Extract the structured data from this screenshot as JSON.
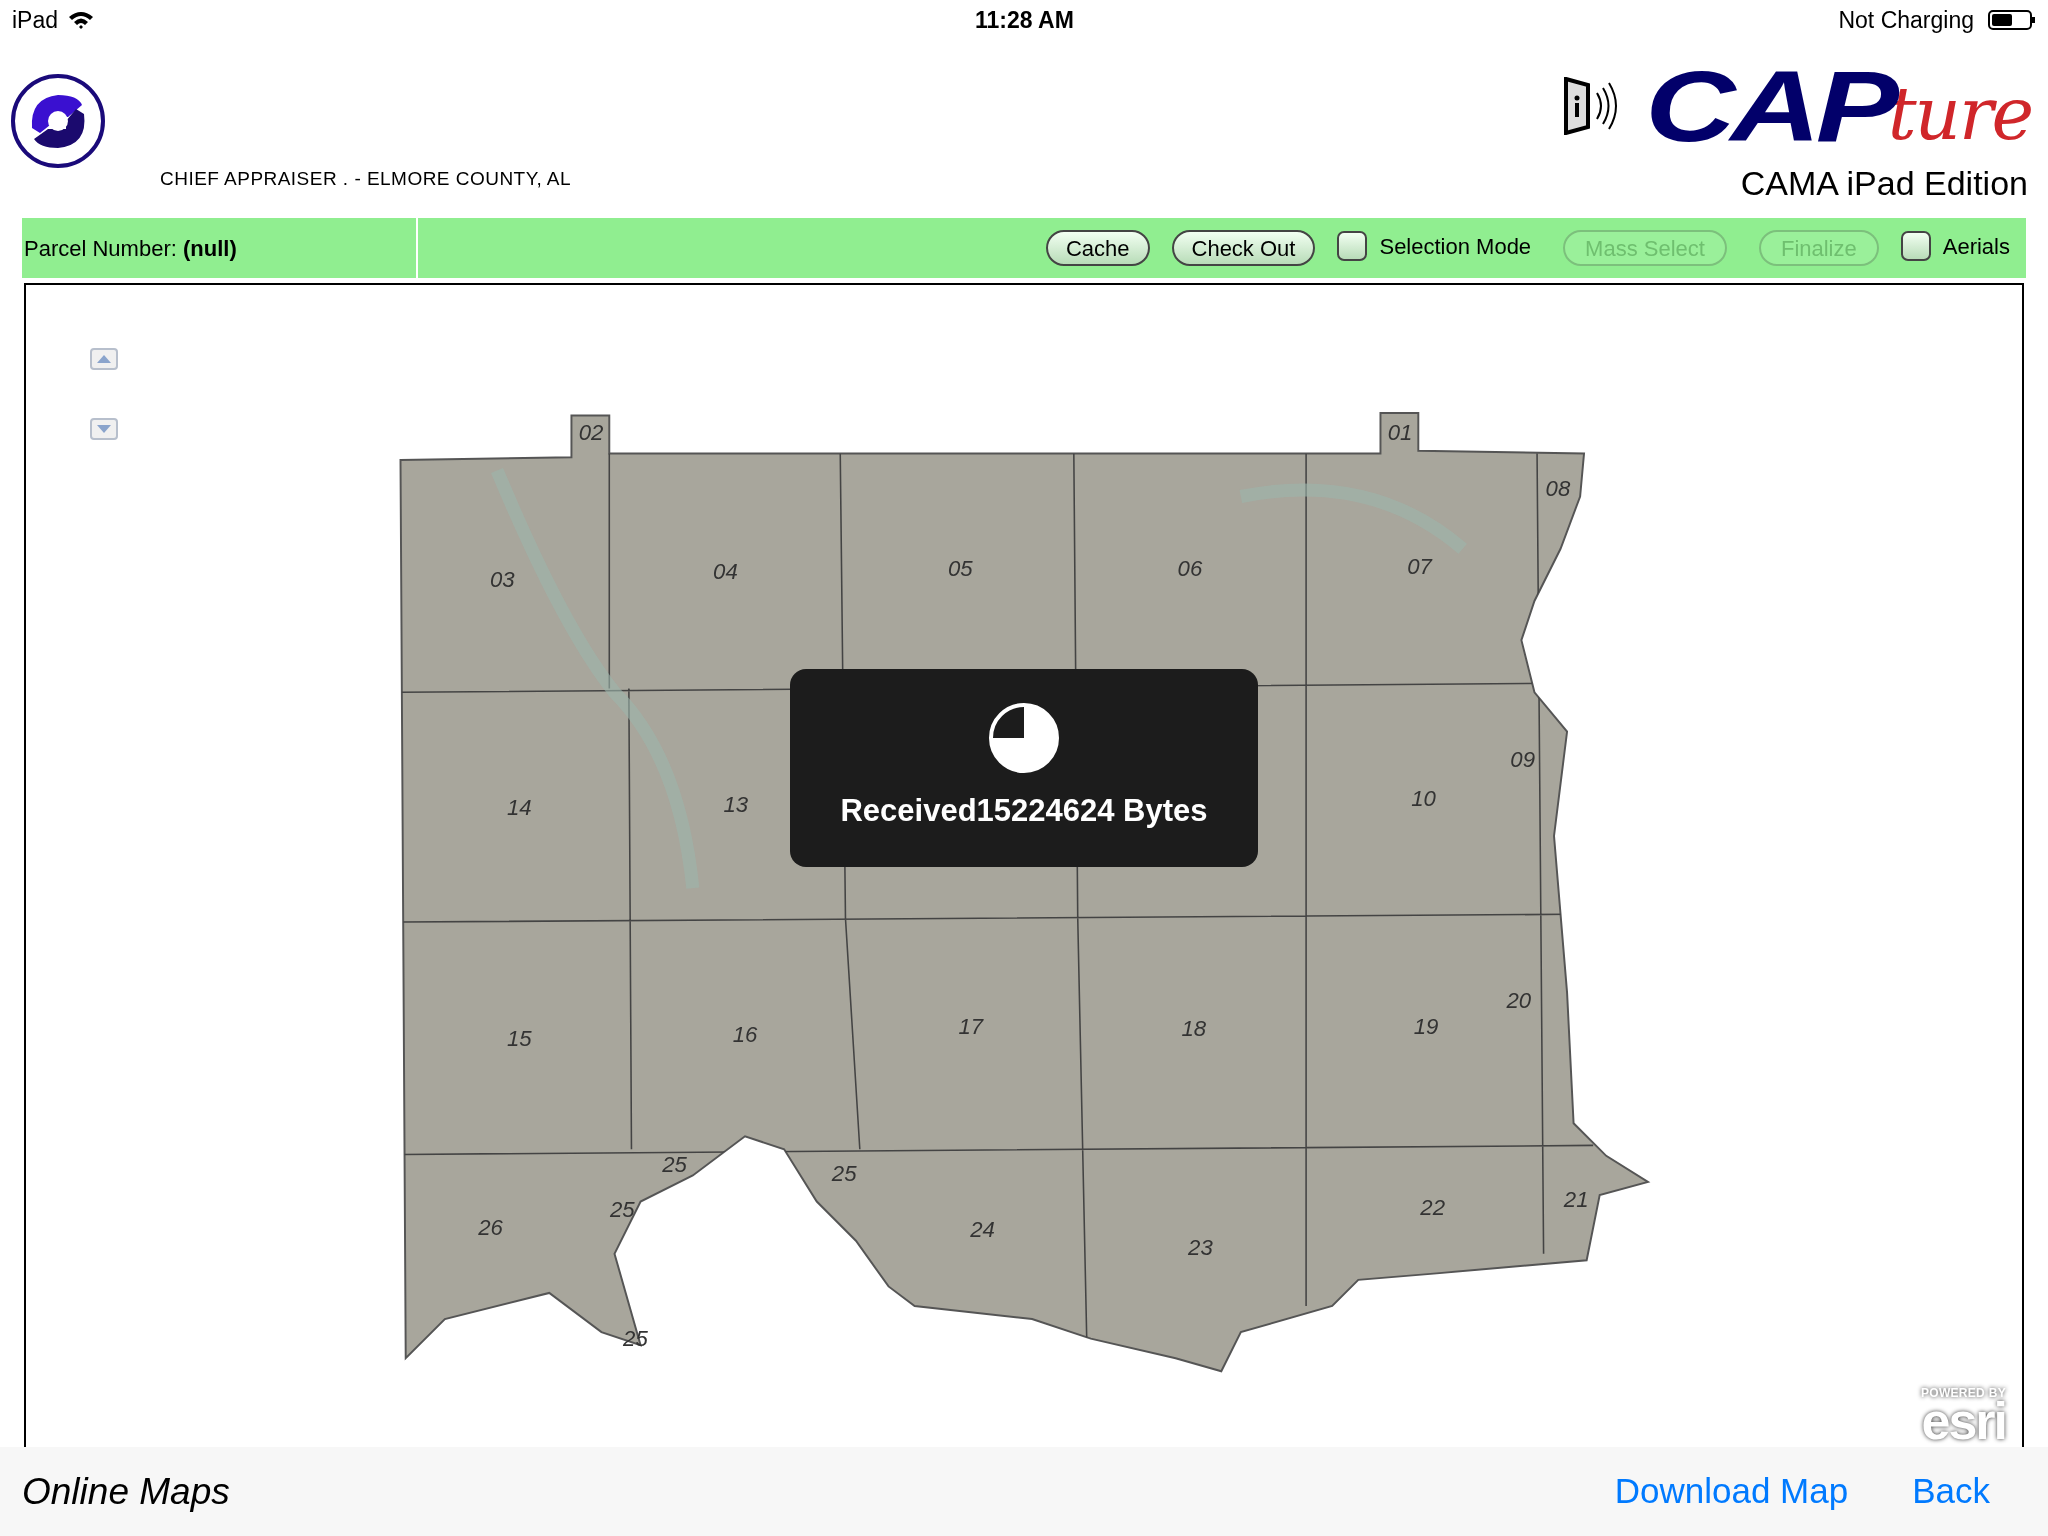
{
  "status_bar": {
    "device": "iPad",
    "time": "11:28 AM",
    "battery_status": "Not Charging"
  },
  "header": {
    "office": "CHIEF APPRAISER . - ELMORE COUNTY, AL",
    "logo_text_main": "CAP",
    "logo_text_script": "ture",
    "subtitle": "CAMA iPad Edition"
  },
  "toolbar": {
    "parcel": "Parcel Number: **(null)**",
    "controls": [
      {
        "kind": "button",
        "label": "Cache",
        "disabled": false
      },
      {
        "kind": "button",
        "label": "Check Out",
        "disabled": false
      },
      {
        "kind": "checkbox",
        "label": "Selection Mode",
        "checked": false
      },
      {
        "kind": "button",
        "label": "Mass Select",
        "disabled": true
      },
      {
        "kind": "button",
        "label": "Finalize",
        "disabled": true
      },
      {
        "kind": "checkbox",
        "label": "Aerials",
        "checked": false
      }
    ]
  },
  "map": {
    "section_labels": [
      "02",
      "01",
      "08",
      "03",
      "04",
      "05",
      "06",
      "07",
      "09",
      "14",
      "13",
      "10",
      "15",
      "16",
      "17",
      "18",
      "19",
      "20",
      "25",
      "25",
      "25",
      "26",
      "24",
      "23",
      "22",
      "21",
      "25"
    ],
    "attribution_small": "POWERED BY",
    "attribution_logo": "esri",
    "loading": {
      "message": "Received15224624 Bytes"
    }
  },
  "footer": {
    "title": "Online Maps",
    "links": [
      "Download Map",
      "Back"
    ]
  }
}
